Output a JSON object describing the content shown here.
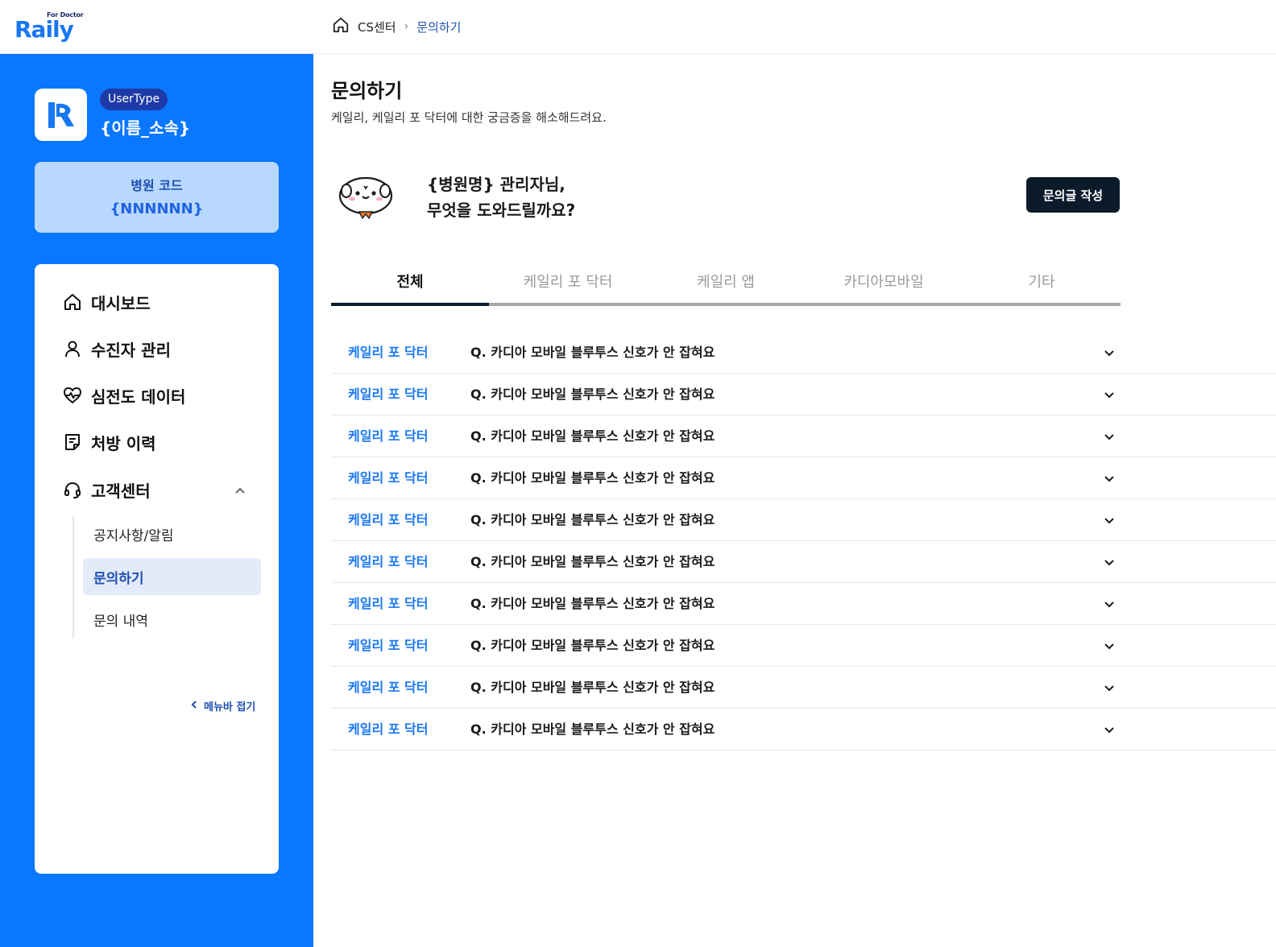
{
  "brand": {
    "logo_super": "For Doctor",
    "logo_word": "Raily",
    "accent": "#0a77ff",
    "dark": "#0c1b2a"
  },
  "breadcrumb": {
    "root": "CS센터",
    "current": "문의하기"
  },
  "profile": {
    "user_type": "UserType",
    "name": "{이름_소속}"
  },
  "hospital": {
    "label": "병원 코드",
    "code": "{NNNNNN}"
  },
  "sidebar": {
    "items": [
      {
        "label": "대시보드",
        "icon": "home-icon"
      },
      {
        "label": "수진자 관리",
        "icon": "user-icon"
      },
      {
        "label": "심전도 데이터",
        "icon": "heart-pulse-icon"
      },
      {
        "label": "처방 이력",
        "icon": "document-icon"
      },
      {
        "label": "고객센터",
        "icon": "headset-icon"
      }
    ],
    "subitems": [
      {
        "label": "공지사항/알림",
        "active": false
      },
      {
        "label": "문의하기",
        "active": true
      },
      {
        "label": "문의 내역",
        "active": false
      }
    ],
    "fold_label": "메뉴바 접기"
  },
  "main": {
    "title": "문의하기",
    "subtitle": "케일리, 케일리 포 닥터에 대한 궁금증을 해소해드려요.",
    "greeting_line1": "{병원명} 관리자님,",
    "greeting_line2": "무엇을 도와드릴까요?",
    "write_button": "문의글 작성"
  },
  "tabs": [
    {
      "label": "전체",
      "active": true
    },
    {
      "label": "케일리 포 닥터",
      "active": false
    },
    {
      "label": "케일리 앱",
      "active": false
    },
    {
      "label": "카디아모바일",
      "active": false
    },
    {
      "label": "기타",
      "active": false
    }
  ],
  "faqs": [
    {
      "category": "케일리 포 닥터",
      "question": "Q. 카디아 모바일 블루투스 신호가 안 잡혀요"
    },
    {
      "category": "케일리 포 닥터",
      "question": "Q. 카디아 모바일 블루투스 신호가 안 잡혀요"
    },
    {
      "category": "케일리 포 닥터",
      "question": "Q. 카디아 모바일 블루투스 신호가 안 잡혀요"
    },
    {
      "category": "케일리 포 닥터",
      "question": "Q. 카디아 모바일 블루투스 신호가 안 잡혀요"
    },
    {
      "category": "케일리 포 닥터",
      "question": "Q. 카디아 모바일 블루투스 신호가 안 잡혀요"
    },
    {
      "category": "케일리 포 닥터",
      "question": "Q. 카디아 모바일 블루투스 신호가 안 잡혀요"
    },
    {
      "category": "케일리 포 닥터",
      "question": "Q. 카디아 모바일 블루투스 신호가 안 잡혀요"
    },
    {
      "category": "케일리 포 닥터",
      "question": "Q. 카디아 모바일 블루투스 신호가 안 잡혀요"
    },
    {
      "category": "케일리 포 닥터",
      "question": "Q. 카디아 모바일 블루투스 신호가 안 잡혀요"
    },
    {
      "category": "케일리 포 닥터",
      "question": "Q. 카디아 모바일 블루투스 신호가 안 잡혀요"
    }
  ]
}
